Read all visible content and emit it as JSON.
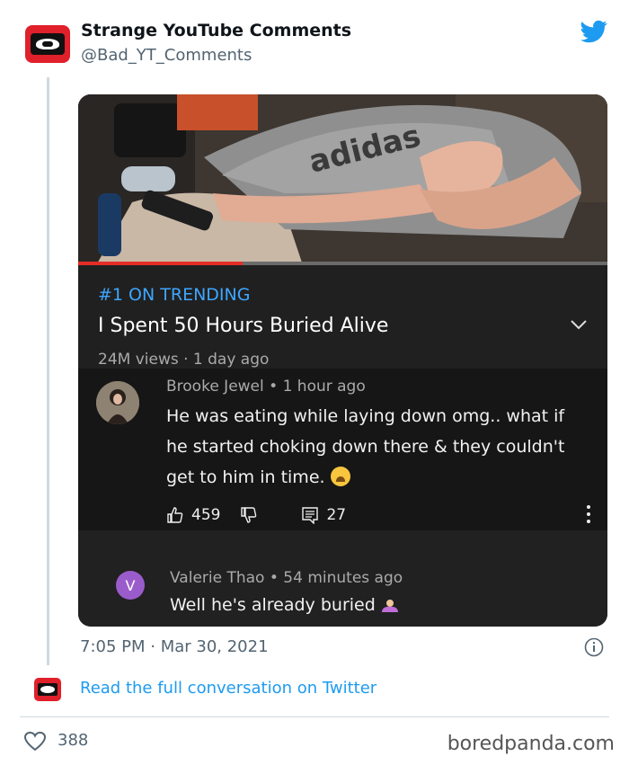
{
  "tweet": {
    "author_name": "Strange YouTube Comments",
    "author_handle": "@Bad_YT_Comments",
    "timestamp": "7:05 PM · Mar 30, 2021",
    "read_link": "Read the full conversation on Twitter",
    "like_count": "388"
  },
  "video": {
    "trending_label": "#1 ON TRENDING",
    "title": "I Spent 50 Hours Buried Alive",
    "meta": "24M views · 1 day ago",
    "progress": 0.31
  },
  "comments": [
    {
      "author": "Brooke Jewel • 1 hour ago",
      "text": "He was eating while laying down omg.. what if he started choking down there & they couldn't get to him in time.",
      "likes": "459",
      "replies": "27"
    },
    {
      "avatar_letter": "V",
      "author": "Valerie Thao • 54 minutes ago",
      "text": "Well he's already buried"
    }
  ],
  "watermark": "boredpanda.com",
  "colors": {
    "twitter_blue": "#1d9bf0",
    "trending_blue": "#3ea6ff",
    "youtube_red": "#e52d27",
    "avatar_purple": "#9b5ccb"
  },
  "icons": [
    "twitter-bird-icon",
    "chevron-down-icon",
    "thumbs-up-icon",
    "thumbs-down-icon",
    "reply-icon",
    "more-vert-icon",
    "info-icon",
    "heart-icon"
  ]
}
